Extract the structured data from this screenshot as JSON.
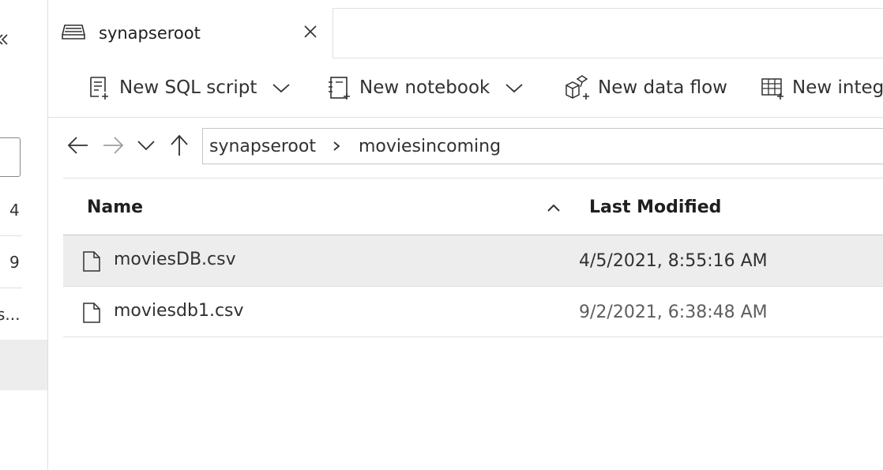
{
  "left_panel": {
    "numbers": [
      "4",
      "9"
    ],
    "truncated_text": "s..."
  },
  "tab": {
    "title": "synapseroot",
    "icon": "storage-icon",
    "close_icon": "close-icon"
  },
  "toolbar": {
    "new_sql_script": "New SQL script",
    "new_notebook": "New notebook",
    "new_data_flow": "New data flow",
    "new_integration": "New integ"
  },
  "breadcrumb": [
    "synapseroot",
    "moviesincoming"
  ],
  "table": {
    "columns": [
      "Name",
      "Last Modified"
    ],
    "rows": [
      {
        "name": "moviesDB.csv",
        "modified": "4/5/2021, 8:55:16 AM",
        "selected": true
      },
      {
        "name": "moviesdb1.csv",
        "modified": "9/2/2021, 6:38:48 AM",
        "selected": false
      }
    ]
  },
  "colors": {
    "selected_row": "#ededed",
    "text": "#323130",
    "muted_text": "#605e5c",
    "border": "#e1dfdd"
  }
}
